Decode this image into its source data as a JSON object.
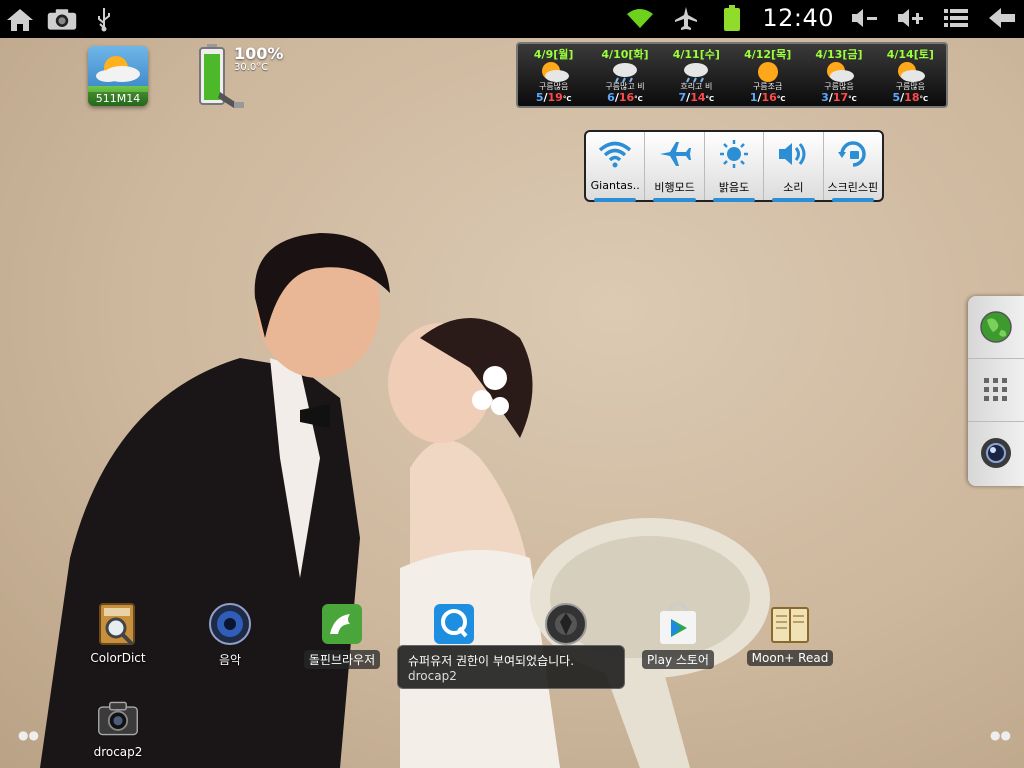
{
  "statusbar": {
    "left_icons": [
      "home-icon",
      "camera-icon",
      "usb-icon"
    ],
    "right_icons": [
      "wifi-icon",
      "airplane-icon",
      "battery-icon"
    ],
    "clock": "12:40",
    "nav_icons": [
      "volume-down-icon",
      "volume-up-icon",
      "menu-icon",
      "back-icon"
    ],
    "wifi_color": "#6cd21e",
    "battery_color": "#8fdc2b"
  },
  "widget_app": {
    "stat": "511M14"
  },
  "battery_widget": {
    "percent": "100%",
    "temp": "30.0°C"
  },
  "weather": {
    "days": [
      {
        "date": "4/9[월]",
        "desc": "구름많음",
        "lo": "5",
        "hi": "19",
        "unit": "°C"
      },
      {
        "date": "4/10[화]",
        "desc": "구름많고 비",
        "lo": "6",
        "hi": "16",
        "unit": "°C"
      },
      {
        "date": "4/11[수]",
        "desc": "흐리고 비",
        "lo": "7",
        "hi": "14",
        "unit": "°C"
      },
      {
        "date": "4/12[목]",
        "desc": "구름조금",
        "lo": "1",
        "hi": "16",
        "unit": "°C"
      },
      {
        "date": "4/13[금]",
        "desc": "구름많음",
        "lo": "3",
        "hi": "17",
        "unit": "°C"
      },
      {
        "date": "4/14[토]",
        "desc": "구름많음",
        "lo": "5",
        "hi": "18",
        "unit": "°C"
      }
    ]
  },
  "toggles": {
    "items": [
      {
        "label": "Giantas..",
        "icon": "wifi-icon"
      },
      {
        "label": "비행모드",
        "icon": "airplane-icon"
      },
      {
        "label": "밝음도",
        "icon": "brightness-icon"
      },
      {
        "label": "소리",
        "icon": "sound-icon"
      },
      {
        "label": "스크린스핀",
        "icon": "screen-rotate-icon"
      }
    ],
    "accent": "#2c8fd6"
  },
  "side_dock": {
    "buttons": [
      "browser-globe-icon",
      "app-drawer-icon",
      "camera-lens-icon"
    ]
  },
  "apps": [
    {
      "label": "ColorDict",
      "icon": "dictionary-icon"
    },
    {
      "label": "음악",
      "icon": "music-speaker-icon"
    },
    {
      "label": "돌핀브라우저",
      "icon": "dolphin-icon"
    },
    {
      "label": "",
      "icon": "quickoffice-icon"
    },
    {
      "label": "",
      "icon": "camera-aperture-icon"
    },
    {
      "label": "Play 스토어",
      "icon": "play-store-icon"
    },
    {
      "label": "Moon+ Read",
      "icon": "moon-reader-icon"
    },
    {
      "label": "drocap2",
      "icon": "camera-icon"
    }
  ],
  "toast": {
    "line1": "슈퍼유저 권한이 부여되었습니다.",
    "line2": "drocap2"
  }
}
